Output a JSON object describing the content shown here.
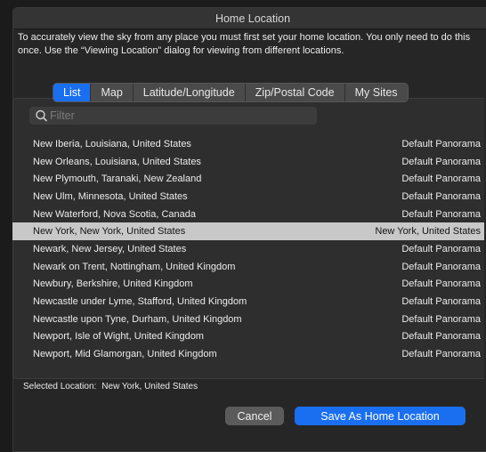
{
  "window": {
    "title": "Home Location"
  },
  "intro_text": "To accurately view the sky from any place you must first set your home location. You only need to do this once. Use the “Viewing Location” dialog for viewing from different locations.",
  "tabs": [
    {
      "label": "List",
      "active": true
    },
    {
      "label": "Map",
      "active": false
    },
    {
      "label": "Latitude/Longitude",
      "active": false
    },
    {
      "label": "Zip/Postal Code",
      "active": false
    },
    {
      "label": "My Sites",
      "active": false
    }
  ],
  "filter": {
    "placeholder": "Filter",
    "value": ""
  },
  "locations": [
    {
      "name": "New Iberia, Louisiana, United States",
      "panorama": "Default Panorama",
      "selected": false
    },
    {
      "name": "New Orleans, Louisiana, United States",
      "panorama": "Default Panorama",
      "selected": false
    },
    {
      "name": "New Plymouth, Taranaki, New Zealand",
      "panorama": "Default Panorama",
      "selected": false
    },
    {
      "name": "New Ulm, Minnesota, United States",
      "panorama": "Default Panorama",
      "selected": false
    },
    {
      "name": "New Waterford, Nova Scotia, Canada",
      "panorama": "Default Panorama",
      "selected": false
    },
    {
      "name": "New York, New York, United States",
      "panorama": "New York, United States",
      "selected": true
    },
    {
      "name": "Newark, New Jersey, United States",
      "panorama": "Default Panorama",
      "selected": false
    },
    {
      "name": "Newark on Trent, Nottingham, United Kingdom",
      "panorama": "Default Panorama",
      "selected": false
    },
    {
      "name": "Newbury, Berkshire, United Kingdom",
      "panorama": "Default Panorama",
      "selected": false
    },
    {
      "name": "Newcastle under Lyme, Stafford, United Kingdom",
      "panorama": "Default Panorama",
      "selected": false
    },
    {
      "name": "Newcastle upon Tyne, Durham, United Kingdom",
      "panorama": "Default Panorama",
      "selected": false
    },
    {
      "name": "Newport, Isle of Wight, United Kingdom",
      "panorama": "Default Panorama",
      "selected": false
    },
    {
      "name": "Newport, Mid Glamorgan, United Kingdom",
      "panorama": "Default Panorama",
      "selected": false
    }
  ],
  "selected_location": {
    "label": "Selected Location:",
    "value": "New York, United States"
  },
  "buttons": {
    "cancel": "Cancel",
    "save": "Save As Home Location"
  },
  "colors": {
    "accent": "#1a6ff0",
    "selection": "#c8c8c8",
    "background": "#262626"
  },
  "icons": {
    "filter": "search-icon"
  }
}
